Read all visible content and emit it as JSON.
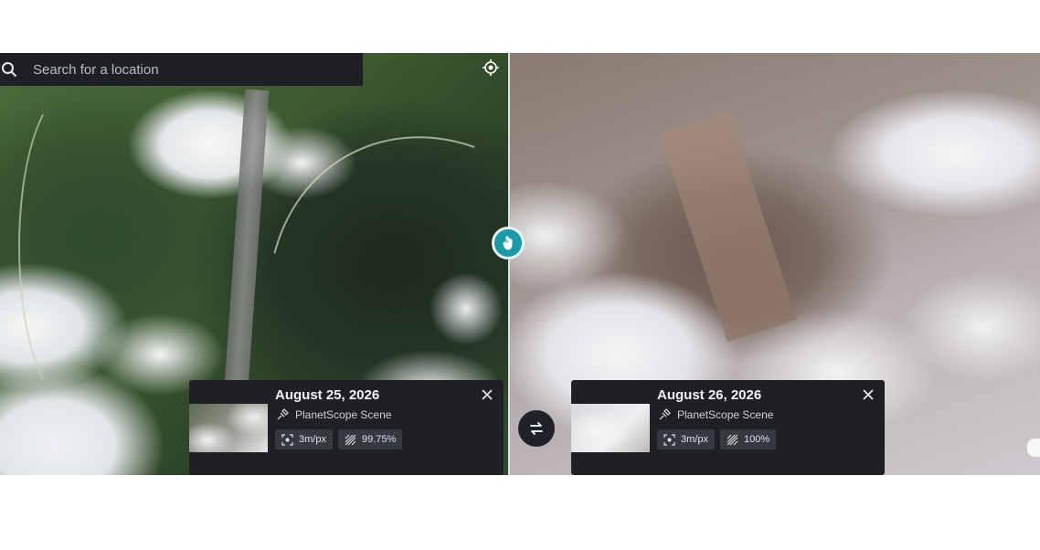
{
  "search": {
    "placeholder": "Search for a location"
  },
  "icons": {
    "search": "search-icon",
    "locate": "crosshair-icon",
    "slider": "hand-cursor-icon",
    "swap": "swap-arrows-icon",
    "close": "close-icon",
    "satellite": "satellite-icon",
    "resolution": "focus-frame-icon",
    "clear_coverage": "hatch-icon"
  },
  "scenes": {
    "left": {
      "date": "August 25, 2026",
      "source": "PlanetScope Scene",
      "resolution": "3m/px",
      "clear": "99.75%"
    },
    "right": {
      "date": "August 26, 2026",
      "source": "PlanetScope Scene",
      "resolution": "3m/px",
      "clear": "100%"
    }
  },
  "colors": {
    "panel": "#1e2026",
    "slider_accent": "#1a9aa6"
  }
}
